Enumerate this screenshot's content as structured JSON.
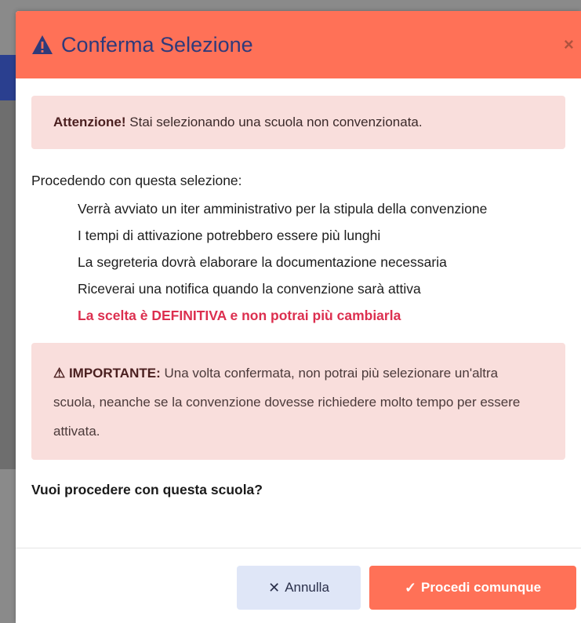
{
  "modal": {
    "title": "Conferma Selezione",
    "close_label": "×"
  },
  "alert_top": {
    "strong": "Attenzione!",
    "text": " Stai selezionando una scuola non convenzionata."
  },
  "lead": "Procedendo con questa selezione:",
  "consequences": [
    "Verrà avviato un iter amministrativo per la stipula della convenzione",
    "I tempi di attivazione potrebbero essere più lunghi",
    "La segreteria dovrà elaborare la documentazione necessaria",
    "Riceverai una notifica quando la convenzione sarà attiva",
    "La scelta è DEFINITIVA e non potrai più cambiarla"
  ],
  "important": {
    "label": "⚠ IMPORTANTE:",
    "text": " Una volta confermata, non potrai più selezionare un'altra scuola, neanche se la convenzione dovesse richiedere molto tempo per essere attivata."
  },
  "question": "Vuoi procedere con questa scuola?",
  "buttons": {
    "cancel": "Annulla",
    "cancel_glyph": "✕",
    "confirm": "Procedi comunque",
    "confirm_glyph": "✓"
  },
  "colors": {
    "header": "#ff7157",
    "title": "#2f3a7a",
    "alert_bg": "#f9dedc",
    "danger_text": "#dc2f4f",
    "cancel_bg": "#dfe6f7"
  }
}
